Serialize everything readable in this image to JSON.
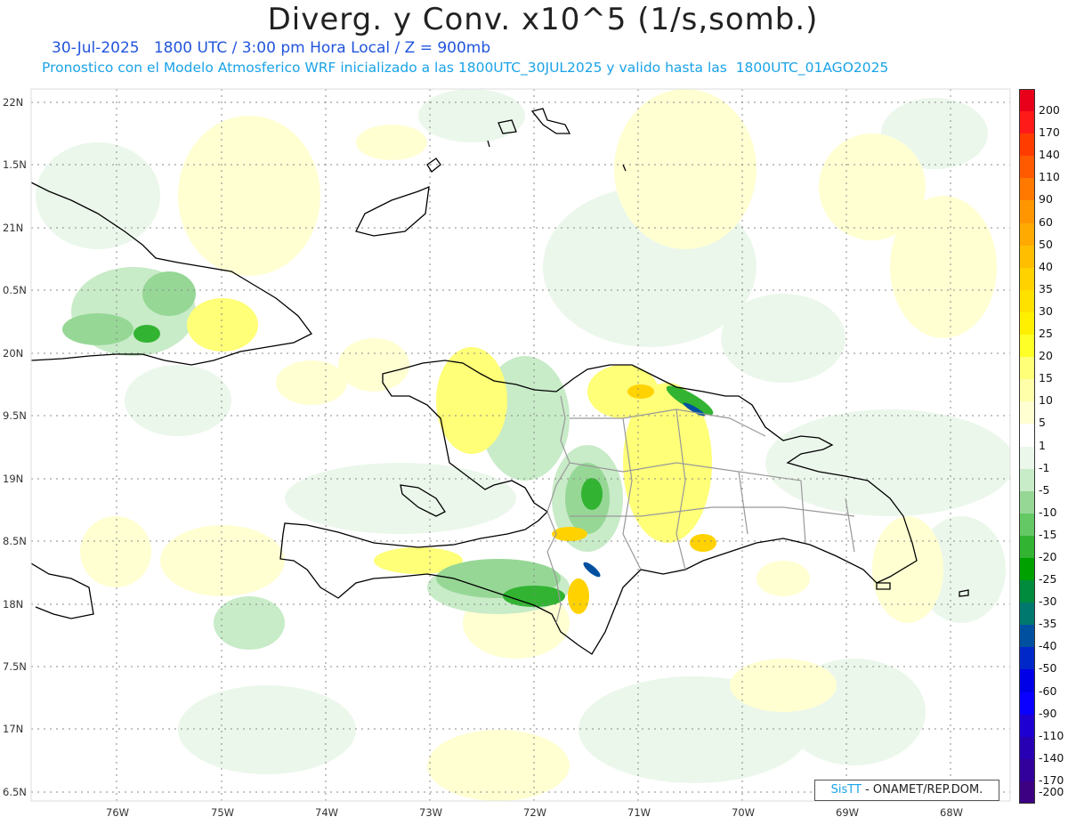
{
  "header": {
    "title": "Diverg. y Conv. x10^5 (1/s,somb.)",
    "line1": "30-Jul-2025   1800 UTC / 3:00 pm Hora Local / Z = 900mb",
    "line2": "Pronostico con el Modelo Atmosferico WRF inicializado a las 1800UTC_30JUL2025 y valido hasta las  1800UTC_01AGO2025"
  },
  "map": {
    "lat_labels": [
      "22N",
      "1.5N",
      "21N",
      "0.5N",
      "20N",
      "9.5N",
      "19N",
      "8.5N",
      "18N",
      "7.5N",
      "17N",
      "6.5N"
    ],
    "lon_labels": [
      "76W",
      "75W",
      "74W",
      "73W",
      "72W",
      "71W",
      "70W",
      "69W",
      "68W"
    ]
  },
  "colorbar": {
    "levels": [
      {
        "label": "200",
        "color": "#e8001a"
      },
      {
        "label": "170",
        "color": "#ff1a1a"
      },
      {
        "label": "140",
        "color": "#ff3c00"
      },
      {
        "label": "110",
        "color": "#ff5a00"
      },
      {
        "label": "90",
        "color": "#ff7800"
      },
      {
        "label": "60",
        "color": "#ff9600"
      },
      {
        "label": "50",
        "color": "#ffaa00"
      },
      {
        "label": "40",
        "color": "#ffbe00"
      },
      {
        "label": "35",
        "color": "#ffd200"
      },
      {
        "label": "30",
        "color": "#ffe100"
      },
      {
        "label": "25",
        "color": "#fff000"
      },
      {
        "label": "20",
        "color": "#ffff28"
      },
      {
        "label": "15",
        "color": "#ffff78"
      },
      {
        "label": "10",
        "color": "#ffffaa"
      },
      {
        "label": "5",
        "color": "#ffffd2"
      },
      {
        "label": "1",
        "color": "#ffffff"
      },
      {
        "label": "-1",
        "color": "#ebf7eb"
      },
      {
        "label": "-5",
        "color": "#c8ebc8"
      },
      {
        "label": "-10",
        "color": "#96d796"
      },
      {
        "label": "-15",
        "color": "#64c864"
      },
      {
        "label": "-20",
        "color": "#32b432"
      },
      {
        "label": "-25",
        "color": "#00a000"
      },
      {
        "label": "-30",
        "color": "#008c3c"
      },
      {
        "label": "-35",
        "color": "#00786e"
      },
      {
        "label": "-40",
        "color": "#0050a0"
      },
      {
        "label": "-50",
        "color": "#0028c8"
      },
      {
        "label": "-60",
        "color": "#0000e6"
      },
      {
        "label": "-90",
        "color": "#0a00ff"
      },
      {
        "label": "-110",
        "color": "#1e00d2"
      },
      {
        "label": "-140",
        "color": "#2800b4"
      },
      {
        "label": "-170",
        "color": "#32009b"
      },
      {
        "label": "-200",
        "color": "#3c0082"
      }
    ]
  },
  "credit": {
    "sis": "SisTT",
    "rest": " - ONAMET/REP.DOM."
  }
}
